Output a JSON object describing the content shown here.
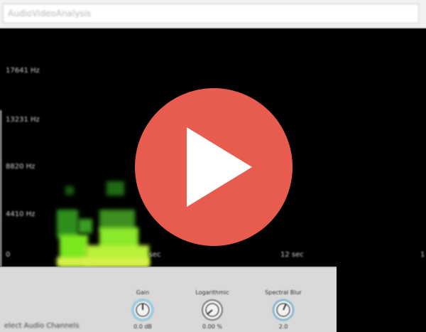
{
  "app": {
    "title": "AudioVideoAnalysis"
  },
  "spectrogram": {
    "frequency_labels": [
      "17641 Hz",
      "13231 Hz",
      "8820 Hz",
      "4410 Hz",
      "0"
    ],
    "time_labels": [
      "6 sec",
      "12 sec",
      "1"
    ]
  },
  "controls": {
    "gain": {
      "label": "Gain",
      "value": "0.0 dB"
    },
    "logarithmic": {
      "label": "Logarithmic",
      "value": "0.00 %"
    },
    "spectral_blur": {
      "label": "Spectral Blur",
      "value": "2.0"
    },
    "channels_label": "elect Audio Channels"
  },
  "overlay": {
    "icon": "play-icon",
    "color": "#e85c4f"
  }
}
